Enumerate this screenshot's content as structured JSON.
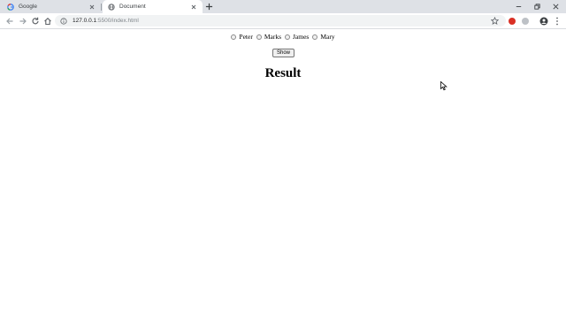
{
  "tabs": [
    {
      "title": "Google",
      "state": "inactive",
      "icon": "google-icon"
    },
    {
      "title": "Document",
      "state": "active",
      "icon": "globe-icon"
    }
  ],
  "toolbar": {
    "url_host": "127.0.0.1",
    "url_rest": ":5500/index.html"
  },
  "page": {
    "options": [
      {
        "label": "Peter",
        "checked": false
      },
      {
        "label": "Marks",
        "checked": false
      },
      {
        "label": "James",
        "checked": false
      },
      {
        "label": "Mary",
        "checked": false
      }
    ],
    "show_label": "Show",
    "result_heading": "Result"
  },
  "colors": {
    "tabstrip_bg": "#dee1e6",
    "omnibox_bg": "#f1f3f4",
    "extension_red": "#d93025"
  }
}
